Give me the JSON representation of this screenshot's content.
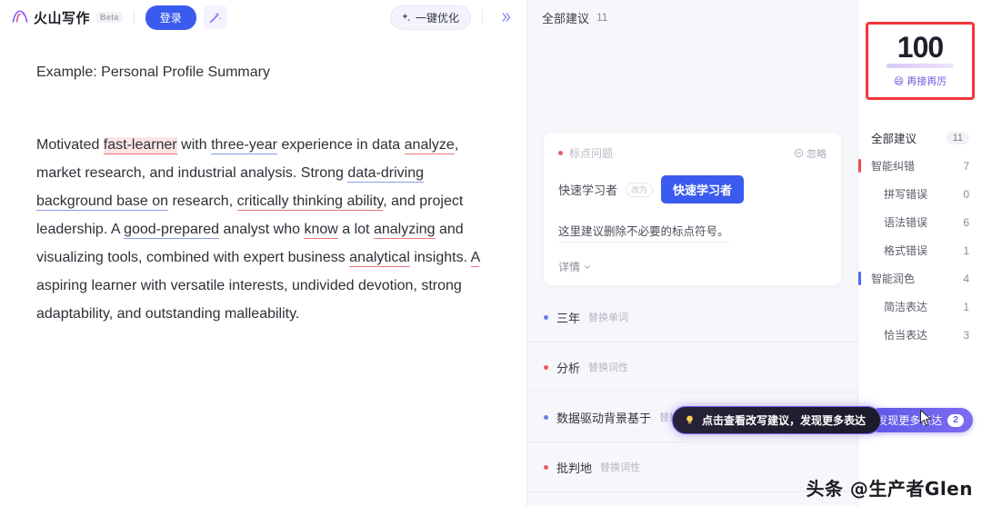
{
  "header": {
    "logo_text": "火山写作",
    "beta_badge": "Beta",
    "login_label": "登录",
    "magic_icon": "magic-wand-icon",
    "optimize_label": "一键优化",
    "optimize_icon": "sparkle-icon",
    "collapse_icon": "double-chevron-right-icon"
  },
  "document": {
    "title": "Example: Personal Profile Summary",
    "paragraph_runs": [
      {
        "text": "Motivated ",
        "style": "plain"
      },
      {
        "text": "fast-learner",
        "style": "error-highlight"
      },
      {
        "text": " with ",
        "style": "plain"
      },
      {
        "text": "three-year",
        "style": "polish"
      },
      {
        "text": " experience in data ",
        "style": "plain"
      },
      {
        "text": "analyze",
        "style": "error"
      },
      {
        "text": ", market research, and industrial analysis. Strong ",
        "style": "plain"
      },
      {
        "text": "data-driving background base on",
        "style": "polish"
      },
      {
        "text": " research, ",
        "style": "plain"
      },
      {
        "text": "critically thinking ability",
        "style": "error"
      },
      {
        "text": ", and project leadership. A ",
        "style": "plain"
      },
      {
        "text": "good-prepared",
        "style": "polish"
      },
      {
        "text": " analyst who ",
        "style": "plain"
      },
      {
        "text": "know",
        "style": "error"
      },
      {
        "text": " a lot ",
        "style": "plain"
      },
      {
        "text": "analyzing",
        "style": "error"
      },
      {
        "text": " and visualizing tools, combined with expert business ",
        "style": "plain"
      },
      {
        "text": "analytical",
        "style": "error"
      },
      {
        "text": " insights. ",
        "style": "plain"
      },
      {
        "text": "A",
        "style": "error"
      },
      {
        "text": " aspiring learner with versatile interests, undivided devotion, strong adaptability, and outstanding malleability.",
        "style": "plain"
      }
    ]
  },
  "suggestions_panel": {
    "header_label": "全部建议",
    "header_count": "11",
    "card": {
      "tag": "标点问题",
      "tag_dot_color": "#ee5b63",
      "ignore_label": "忽略",
      "ignore_icon": "circle-minus-icon",
      "original_text": "快速学习者",
      "arrow_chip": "改为",
      "replacement_text": "快速学习者",
      "description": "这里建议删除不必要的标点符号。",
      "more_label": "详情",
      "more_icon": "chevron-down-icon"
    },
    "items": [
      {
        "text": "三年",
        "kind": "替换单词",
        "dot_color": "#6d7ce8"
      },
      {
        "text": "分析",
        "kind": "替换词性",
        "dot_color": "#ee5b63"
      },
      {
        "text": "数据驱动背景基于",
        "kind": "替换短语",
        "dot_color": "#6d7ce8"
      },
      {
        "text": "批判地",
        "kind": "替换词性",
        "dot_color": "#ee5b63"
      }
    ]
  },
  "tooltip": {
    "icon": "lightbulb-icon",
    "text": "点击查看改写建议，发现更多表达"
  },
  "stats_panel": {
    "score": "100",
    "score_label": "再接再厉",
    "score_emoji": "😄",
    "score_border_color": "#f5353b",
    "rows": [
      {
        "name": "全部建议",
        "value": "11",
        "type": "header",
        "bar": null
      },
      {
        "name": "智能纠错",
        "value": "7",
        "type": "group",
        "bar": "#ee4b54"
      },
      {
        "name": "拼写错误",
        "value": "0",
        "type": "child",
        "bar": null
      },
      {
        "name": "语法错误",
        "value": "6",
        "type": "child",
        "bar": null
      },
      {
        "name": "格式错误",
        "value": "1",
        "type": "child",
        "bar": null
      },
      {
        "name": "智能润色",
        "value": "4",
        "type": "group",
        "bar": "#4f6cf5"
      },
      {
        "name": "简洁表达",
        "value": "1",
        "type": "child",
        "bar": null
      },
      {
        "name": "恰当表达",
        "value": "3",
        "type": "child",
        "bar": null
      }
    ],
    "discover_label": "发现更多表达",
    "discover_badge": "2"
  },
  "watermark": "头条 @生产者Glen"
}
